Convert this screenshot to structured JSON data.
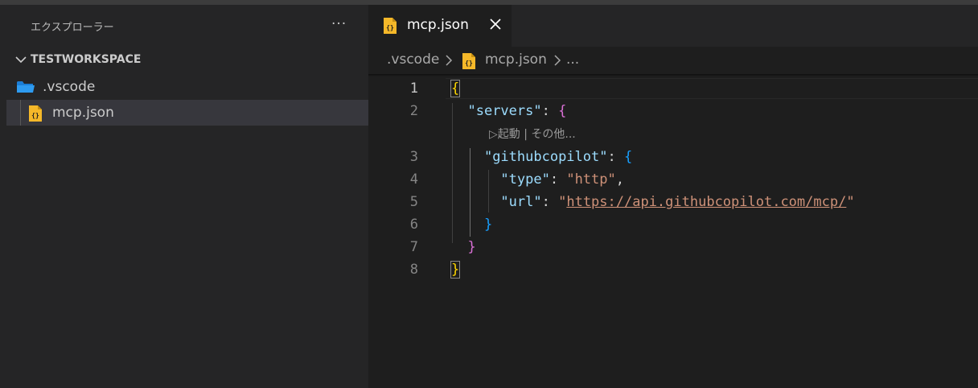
{
  "sidebar": {
    "header": "エクスプローラー",
    "more_actions": "···",
    "workspace_name": "TESTWORKSPACE",
    "items": [
      {
        "label": ".vscode",
        "kind": "folder",
        "icon": "folder-icon"
      },
      {
        "label": "mcp.json",
        "kind": "file",
        "icon": "json-file-icon",
        "selected": true
      }
    ]
  },
  "editor": {
    "tab": {
      "label": "mcp.json",
      "icon": "json-file-icon"
    },
    "breadcrumb": [
      ".vscode",
      "mcp.json",
      "..."
    ],
    "code_lens": "▷起動 | その他...",
    "active_line": 1,
    "lines": [
      {
        "num": "1",
        "tokens": [
          {
            "t": "{",
            "c": "#ffd700"
          }
        ]
      },
      {
        "num": "2",
        "tokens": [
          {
            "t": "  ",
            "c": "#d4d4d4"
          },
          {
            "t": "\"servers\"",
            "c": "#9cdcfe"
          },
          {
            "t": ": ",
            "c": "#d4d4d4"
          },
          {
            "t": "{",
            "c": "#da70d6"
          }
        ]
      },
      {
        "num": "3",
        "tokens": [
          {
            "t": "    ",
            "c": "#d4d4d4"
          },
          {
            "t": "\"githubcopilot\"",
            "c": "#9cdcfe"
          },
          {
            "t": ": ",
            "c": "#d4d4d4"
          },
          {
            "t": "{",
            "c": "#179fff"
          }
        ]
      },
      {
        "num": "4",
        "tokens": [
          {
            "t": "      ",
            "c": "#d4d4d4"
          },
          {
            "t": "\"type\"",
            "c": "#9cdcfe"
          },
          {
            "t": ": ",
            "c": "#d4d4d4"
          },
          {
            "t": "\"http\"",
            "c": "#ce9178"
          },
          {
            "t": ",",
            "c": "#d4d4d4"
          }
        ]
      },
      {
        "num": "5",
        "tokens": [
          {
            "t": "      ",
            "c": "#d4d4d4"
          },
          {
            "t": "\"url\"",
            "c": "#9cdcfe"
          },
          {
            "t": ": ",
            "c": "#d4d4d4"
          },
          {
            "t": "\"",
            "c": "#ce9178"
          },
          {
            "t": "https://api.githubcopilot.com/mcp/",
            "c": "#ce9178",
            "link": true
          },
          {
            "t": "\"",
            "c": "#ce9178"
          }
        ]
      },
      {
        "num": "6",
        "tokens": [
          {
            "t": "    ",
            "c": "#d4d4d4"
          },
          {
            "t": "}",
            "c": "#179fff"
          }
        ]
      },
      {
        "num": "7",
        "tokens": [
          {
            "t": "  ",
            "c": "#d4d4d4"
          },
          {
            "t": "}",
            "c": "#da70d6"
          }
        ]
      },
      {
        "num": "8",
        "tokens": [
          {
            "t": "}",
            "c": "#ffd700"
          }
        ]
      }
    ]
  },
  "colors": {
    "sidebar_bg": "#252526",
    "editor_bg": "#1e1e1e",
    "selection_bg": "#37373d",
    "json_icon": "#f5b829",
    "folder_icon": "#1b7ed6"
  }
}
